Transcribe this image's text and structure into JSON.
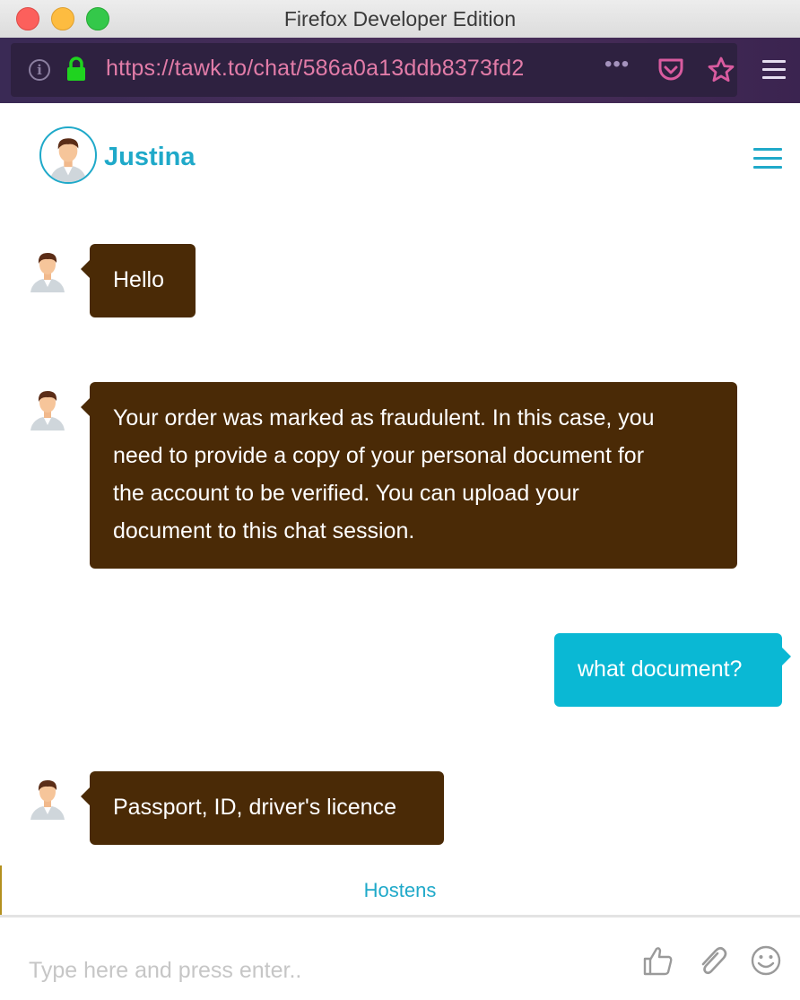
{
  "window": {
    "title": "Firefox Developer Edition"
  },
  "browser": {
    "url": "https://tawk.to/chat/586a0a13ddb8373fd2",
    "overflow_label": "•••"
  },
  "chat": {
    "agent_name": "Justina",
    "messages": [
      {
        "from": "agent",
        "text": "Hello"
      },
      {
        "from": "agent",
        "lines": [
          "Your order was marked as fraudulent. In this case, you",
          "need to provide a copy of your personal document for",
          "the account to be verified. You can upload your",
          "document to this chat session."
        ]
      },
      {
        "from": "visitor",
        "text": "what document?"
      },
      {
        "from": "agent",
        "text": "Passport, ID, driver's licence"
      }
    ],
    "brand": "Hostens",
    "input_placeholder": "Type here and press enter..",
    "colors": {
      "accent": "#1fa9c9",
      "agent_bubble": "#4a2a06",
      "visitor_bubble": "#0ab8d4"
    }
  }
}
